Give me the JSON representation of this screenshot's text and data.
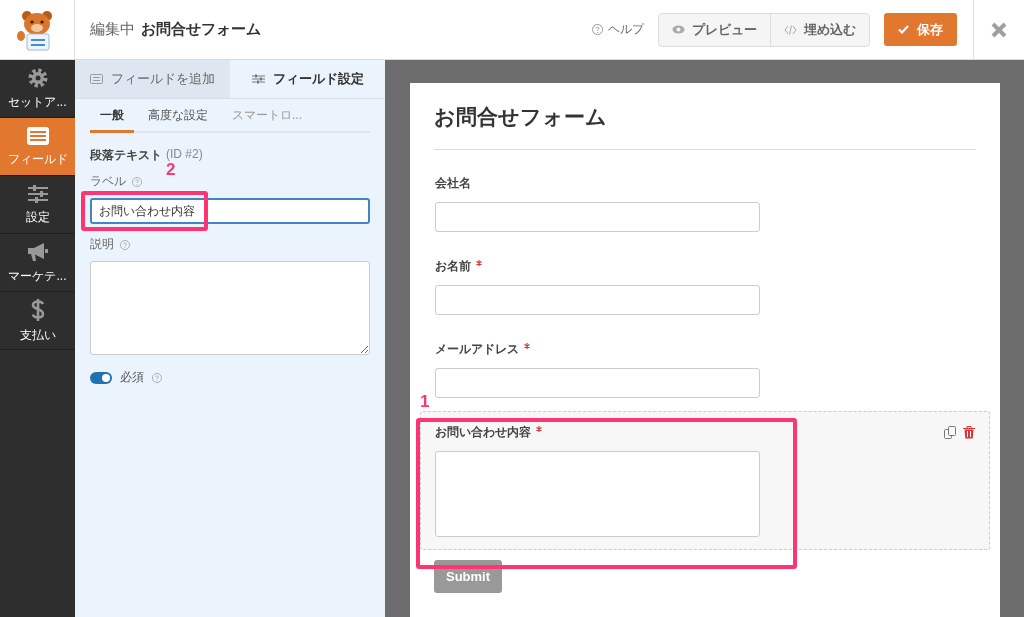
{
  "header": {
    "editing_label": "編集中",
    "form_name": "お問合せフォーム",
    "help": "ヘルプ",
    "preview": "プレビュー",
    "embed": "埋め込む",
    "save": "保存"
  },
  "nav": [
    {
      "kind": "gear",
      "label": "セットア...",
      "selected": false
    },
    {
      "kind": "list",
      "label": "フィールド",
      "selected": true
    },
    {
      "kind": "sliders",
      "label": "設定",
      "selected": false
    },
    {
      "kind": "megaphone",
      "label": "マーケテ...",
      "selected": false
    },
    {
      "kind": "dollar",
      "label": "支払い",
      "selected": false
    }
  ],
  "panel": {
    "tabs": [
      {
        "kind": "add",
        "label": "フィールドを追加",
        "selected": false
      },
      {
        "kind": "settings",
        "label": "フィールド設定",
        "selected": true
      }
    ],
    "subtabs": [
      {
        "label": "一般",
        "selected": true
      },
      {
        "label": "高度な設定",
        "selected": false
      },
      {
        "label": "スマートロ...",
        "selected": false
      }
    ],
    "field_type": "段落テキスト",
    "field_id": "(ID #2)",
    "label_caption": "ラベル",
    "label_value": "お問い合わせ内容",
    "description_caption": "説明",
    "required": {
      "label": "必須",
      "on": true
    }
  },
  "form": {
    "title": "お問合せフォーム",
    "fields": [
      {
        "kind": "text",
        "label": "会社名",
        "required": false,
        "selected": false
      },
      {
        "kind": "text",
        "label": "お名前",
        "required": true,
        "selected": false
      },
      {
        "kind": "text",
        "label": "メールアドレス",
        "required": true,
        "selected": false
      },
      {
        "kind": "textarea",
        "label": "お問い合わせ内容",
        "required": true,
        "selected": true
      }
    ],
    "submit": "Submit"
  },
  "annotations": [
    {
      "number": "1"
    },
    {
      "number": "2"
    }
  ]
}
